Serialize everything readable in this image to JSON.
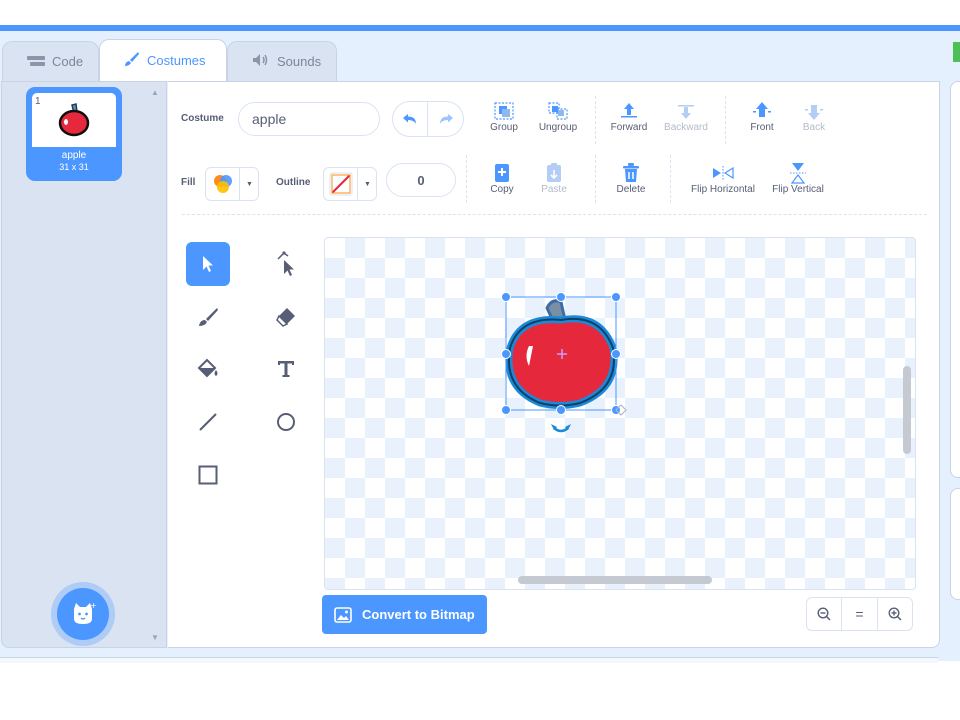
{
  "tabs": [
    {
      "label": "Code",
      "icon": "code-icon"
    },
    {
      "label": "Costumes",
      "icon": "brush-icon"
    },
    {
      "label": "Sounds",
      "icon": "speaker-icon"
    }
  ],
  "costume_list": {
    "items": [
      {
        "number": "1",
        "name": "apple",
        "size": "31 x 31"
      }
    ]
  },
  "toolbar": {
    "costume_label": "Costume",
    "costume_name": "apple",
    "fill_label": "Fill",
    "outline_label": "Outline",
    "outline_width": "0",
    "group": "Group",
    "ungroup": "Ungroup",
    "forward": "Forward",
    "backward": "Backward",
    "front": "Front",
    "back": "Back",
    "copy": "Copy",
    "paste": "Paste",
    "delete": "Delete",
    "flip_horizontal": "Flip Horizontal",
    "flip_vertical": "Flip Vertical"
  },
  "canvas": {
    "convert_label": "Convert to Bitmap",
    "zoom_reset_label": "="
  },
  "colors": {
    "accent": "#4c97ff",
    "apple_red": "#e6283c",
    "outline": "#0f3f6b",
    "panel_bg": "#e5f0ff",
    "green_flag": "#4cbf56"
  }
}
